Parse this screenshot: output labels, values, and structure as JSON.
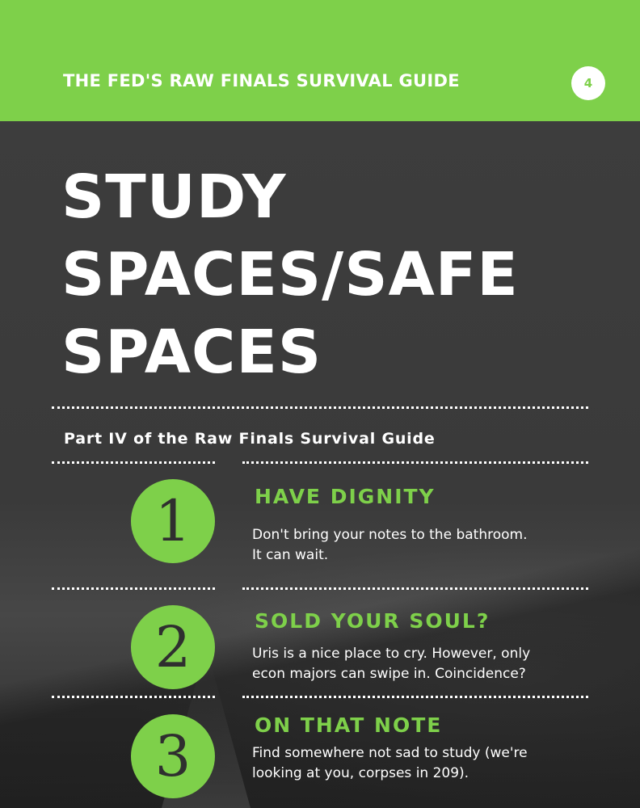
{
  "header": {
    "title": "THE FED'S RAW FINALS SURVIVAL GUIDE",
    "page_number": "4"
  },
  "title": {
    "lines": [
      "STUDY",
      "SPACES/SAFE",
      "SPACES"
    ]
  },
  "subtitle": "Part IV of the Raw Finals Survival Guide",
  "items": [
    {
      "number": "1",
      "heading": "HAVE DIGNITY",
      "text": "Don't bring your notes to the bathroom.\n It can wait."
    },
    {
      "number": "2",
      "heading": "SOLD YOUR SOUL?",
      "text": "Uris is a nice place to cry.  However, only\necon majors can swipe in.  Coincidence?"
    },
    {
      "number": "3",
      "heading": "ON THAT NOTE",
      "text": "Find somewhere not sad to study (we're\nlooking at you, corpses in 209)."
    }
  ],
  "colors": {
    "accent": "#7ed04a",
    "background": "#3a3a3a",
    "text": "#ffffff"
  }
}
